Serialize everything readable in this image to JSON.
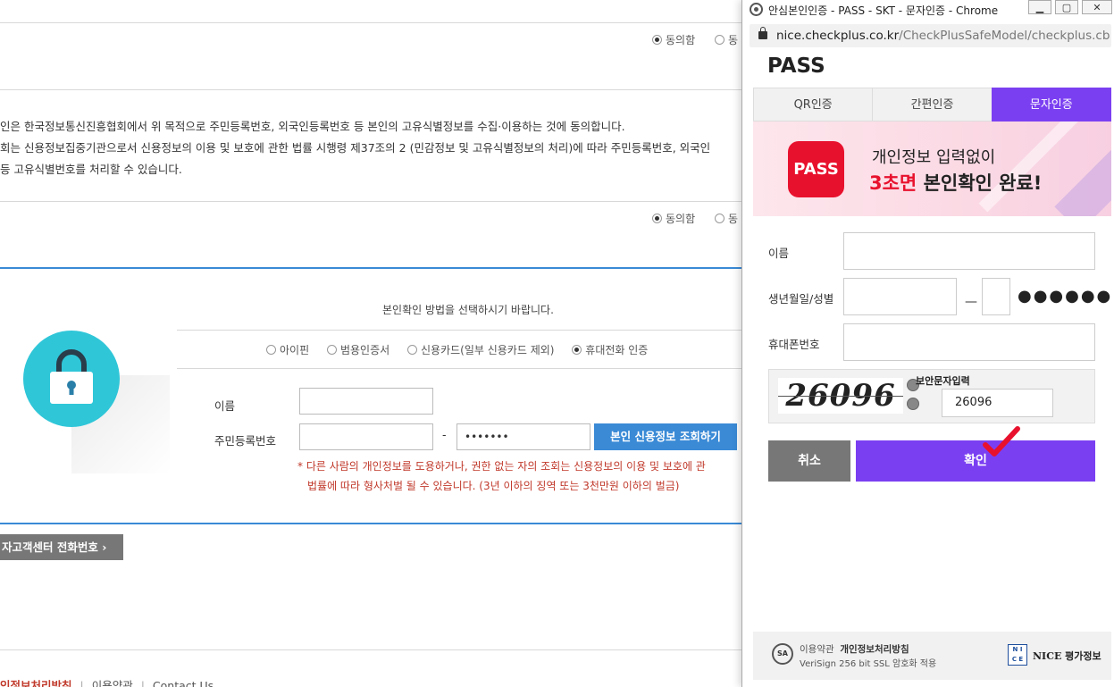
{
  "page": {
    "agree_label": "동의함",
    "consent_lines": [
      "인은 한국정보통신진흥협회에서 위 목적으로 주민등록번호, 외국인등록번호 등 본인의 고유식별정보를 수집·이용하는 것에 동의합니다.",
      "회는 신용정보집중기관으로서 신용정보의 이용 및 보호에 관한 법률 시행령 제37조의 2 (민감정보 및 고유식별정보의 처리)에 따라 주민등록번호, 외국인",
      "등 고유식별번호를 처리할 수 있습니다."
    ],
    "method_title": "본인확인 방법을 선택하시기 바랍니다.",
    "methods": [
      "아이핀",
      "범용인증서",
      "신용카드(일부 신용카드 제외)",
      "휴대전화 인증"
    ],
    "selected_method": "휴대전화 인증",
    "name_label": "이름",
    "rrn_label": "주민등록번호",
    "rrn_dash": "-",
    "rrn_back_value": "•••••••",
    "credit_button": "본인 신용정보 조회하기",
    "warning_line1": "*  다른 사람의 개인정보를 도용하거나, 권한 없는 자의 조회는 신용정보의 이용 및 보호에 관",
    "warning_line2": "법률에 따라 형사처벌 될 수 있습니다. (3년 이하의 징역 또는 3천만원 이하의 벌금)",
    "call_center_button": "자고객센터 전화번호 ›",
    "footer_links": [
      "인정보처리방침",
      "이용약관",
      "Contact Us"
    ]
  },
  "popup": {
    "window_title": "안심본인인증 - PASS - SKT - 문자인증 - Chrome",
    "url_host": "nice.checkplus.co.kr",
    "url_path": "/CheckPlusSafeModel/checkplus.cb",
    "brand": "PASS",
    "tabs": [
      "QR인증",
      "간편인증",
      "문자인증"
    ],
    "active_tab": "문자인증",
    "banner_badge": "PASS",
    "banner_line1": "개인정보 입력없이",
    "banner_highlight": "3초면",
    "banner_line2_rest": " 본인확인 완료!",
    "name_label": "이름",
    "birth_label": "생년월일/성별",
    "birth_dash": "—",
    "masked_digits": "●●●●●●",
    "phone_label": "휴대폰번호",
    "captcha_text": "26096",
    "captcha_input_label": "보안문자입력",
    "captcha_input_value": "26096",
    "cancel_button": "취소",
    "confirm_button": "확인",
    "footer_terms": "이용약관",
    "footer_privacy": "개인정보처리방침",
    "footer_ssl": "VeriSign 256 bit SSL 암호화 적용",
    "footer_nice": "NICE 평가정보"
  },
  "colors": {
    "accent_purple": "#7b3ff2",
    "pass_red": "#e8112d",
    "blue_button": "#3a8ad6"
  }
}
